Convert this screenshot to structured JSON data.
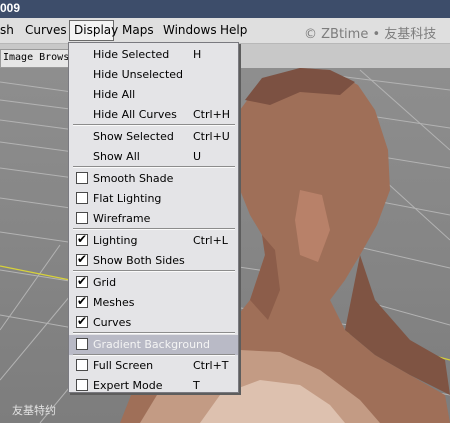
{
  "window": {
    "title": "009"
  },
  "menubar": {
    "items": [
      "sh",
      "Curves",
      "Display",
      "Maps",
      "Windows",
      "Help"
    ],
    "watermark": "© ZBtime • 友基科技"
  },
  "toolbar": {
    "tab_label": "Image Brows"
  },
  "viewport": {
    "bottom_watermark": "友基特约"
  },
  "display_menu": {
    "items": [
      {
        "label": "Hide Selected",
        "shortcut": "H"
      },
      {
        "label": "Hide Unselected",
        "shortcut": ""
      },
      {
        "label": "Hide All",
        "shortcut": ""
      },
      {
        "label": "Hide All Curves",
        "shortcut": "Ctrl+H"
      },
      {
        "label": "Show Selected",
        "shortcut": "Ctrl+U"
      },
      {
        "label": "Show All",
        "shortcut": "U"
      },
      {
        "label": "Smooth Shade",
        "shortcut": "",
        "checked": false
      },
      {
        "label": "Flat Lighting",
        "shortcut": "",
        "checked": false
      },
      {
        "label": "Wireframe",
        "shortcut": "",
        "checked": false
      },
      {
        "label": "Lighting",
        "shortcut": "Ctrl+L",
        "checked": true
      },
      {
        "label": "Show Both Sides",
        "shortcut": "",
        "checked": true
      },
      {
        "label": "Grid",
        "shortcut": "",
        "checked": true
      },
      {
        "label": "Meshes",
        "shortcut": "",
        "checked": true
      },
      {
        "label": "Curves",
        "shortcut": "",
        "checked": true
      },
      {
        "label": "Gradient Background",
        "shortcut": "",
        "checked": false,
        "highlighted": true
      },
      {
        "label": "Full Screen",
        "shortcut": "Ctrl+T",
        "checked": false
      },
      {
        "label": "Expert Mode",
        "shortcut": "T",
        "checked": false
      }
    ]
  },
  "colors": {
    "title_bar": "#3d4d6a",
    "menu_background": "#e4e4e7",
    "highlight": "#b9bac6",
    "skin": "#a0705a",
    "viewport": "#8a8a8a"
  }
}
